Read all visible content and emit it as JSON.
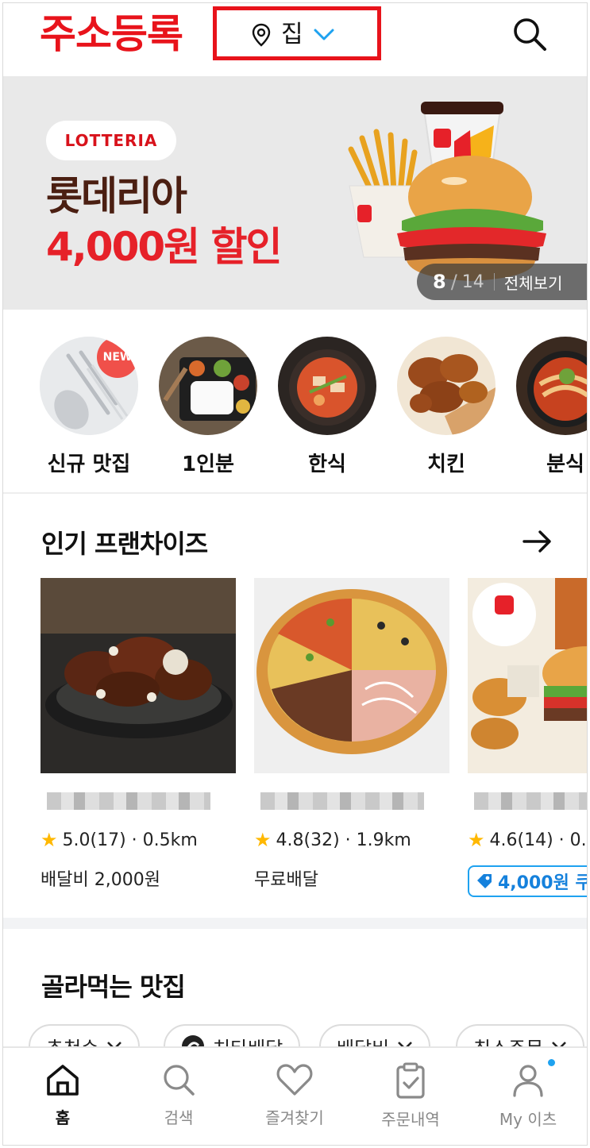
{
  "annotation": {
    "label": "주소등록"
  },
  "header": {
    "address_label": "집",
    "icons": [
      "map-pin-icon",
      "chevron-down-icon",
      "search-icon"
    ]
  },
  "banner": {
    "brand": "LOTTERIA",
    "title": "롯데리아",
    "subtitle": "4,000원 할인",
    "page_current": "8",
    "page_separator": "/",
    "page_total": "14",
    "view_all": "전체보기"
  },
  "categories": [
    {
      "label": "신규 맛집",
      "badge": "NEW"
    },
    {
      "label": "1인분"
    },
    {
      "label": "한식"
    },
    {
      "label": "치킨"
    },
    {
      "label": "분식"
    }
  ],
  "popular": {
    "title": "인기 프랜차이즈",
    "cards": [
      {
        "rating": "5.0(17)",
        "distance": "· 0.5km",
        "fee": "배달비 2,000원"
      },
      {
        "rating": "4.8(32)",
        "distance": "· 1.9km",
        "fee": "무료배달"
      },
      {
        "rating": "4.6(14)",
        "distance": "· 0.",
        "coupon": "4,000원 쿠"
      }
    ]
  },
  "picks": {
    "title": "골라먹는 맛집",
    "chips": [
      "추천순",
      "치타배달",
      "배달비",
      "최소주문"
    ]
  },
  "tabbar": {
    "items": [
      {
        "label": "홈",
        "icon": "home-icon",
        "active": true
      },
      {
        "label": "검색",
        "icon": "search-icon"
      },
      {
        "label": "즐겨찾기",
        "icon": "heart-icon"
      },
      {
        "label": "주문내역",
        "icon": "clipboard-check-icon"
      },
      {
        "label": "My 이츠",
        "icon": "person-icon"
      }
    ]
  },
  "colors": {
    "accent_red": "#e8131b",
    "brand_blue": "#1ea2f0",
    "banner_bg": "#e9e9e9"
  }
}
